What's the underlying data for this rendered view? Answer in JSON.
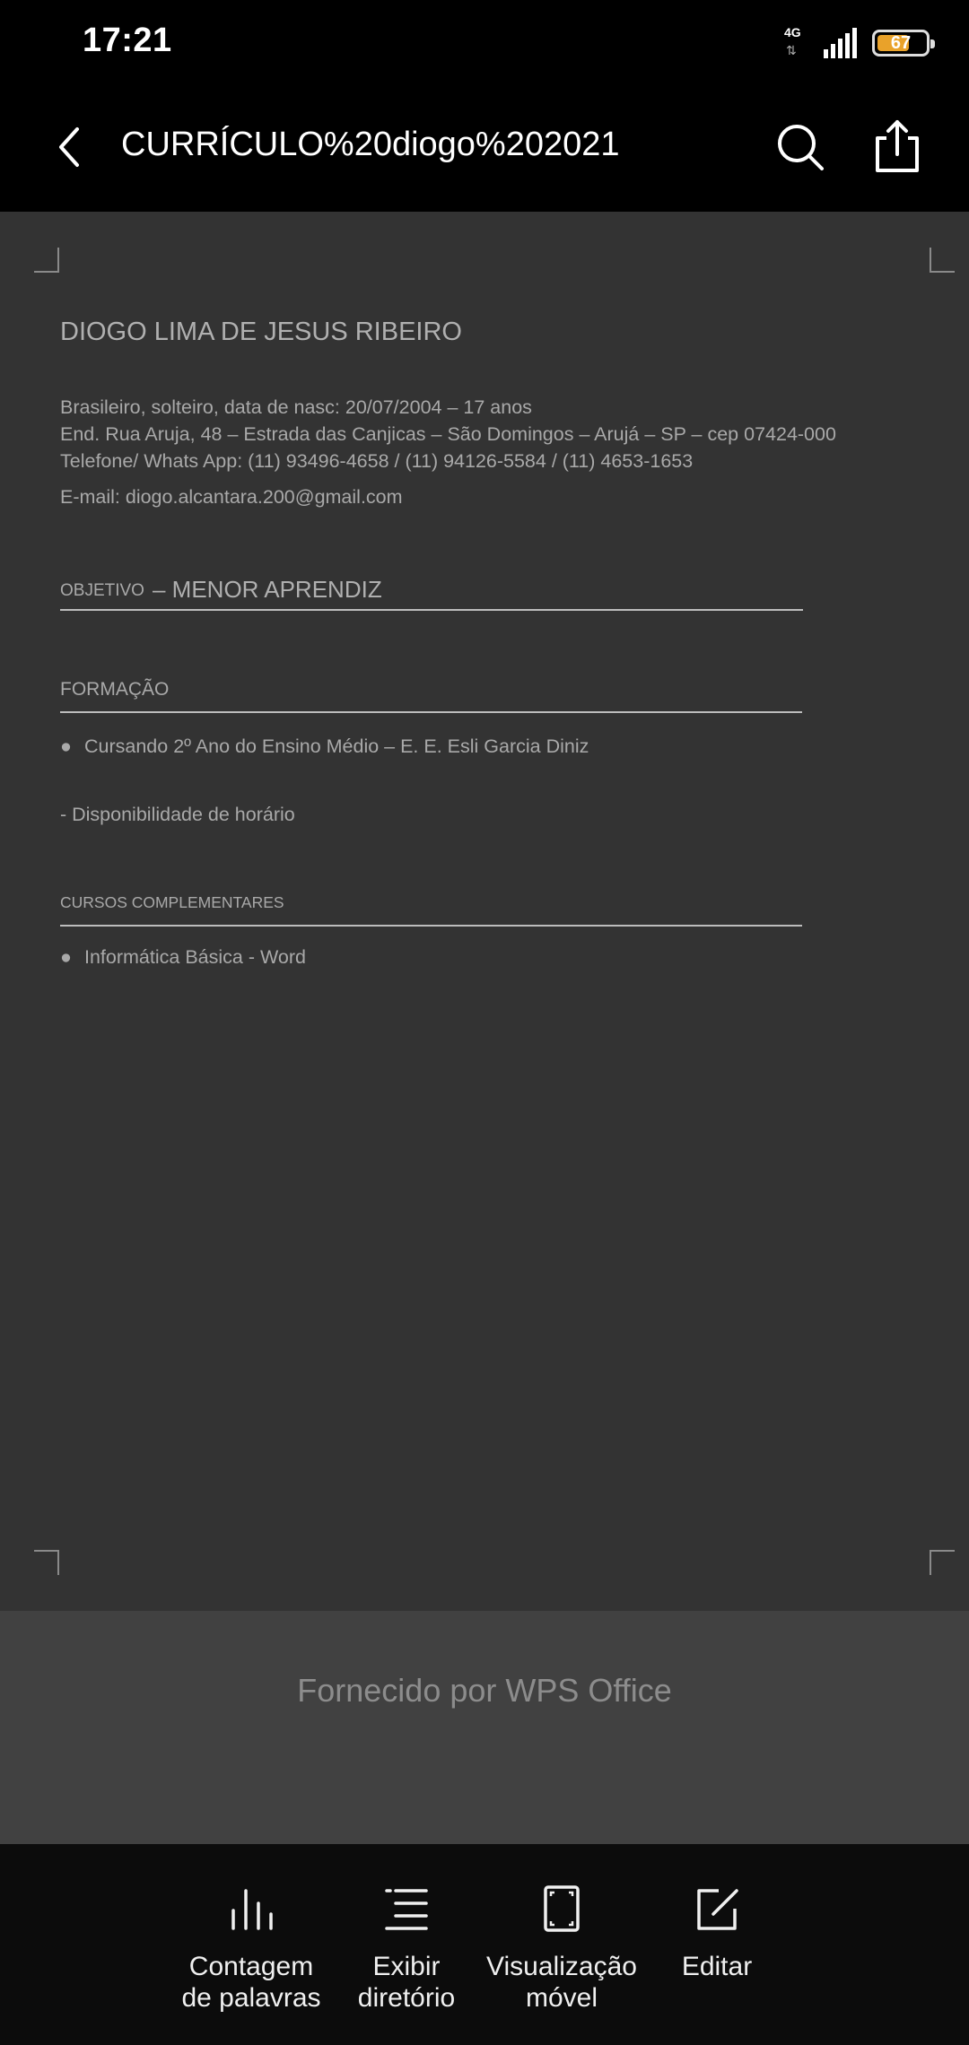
{
  "status_bar": {
    "time": "17:21",
    "network": "4G",
    "battery": "67",
    "battery_level": 0.67
  },
  "app_bar": {
    "title": "CURRÍCULO%20diogo%202021",
    "back_icon": "chevron-left-icon",
    "search_icon": "search-icon",
    "share_icon": "share-icon"
  },
  "document": {
    "name": "DIOGO LIMA DE JESUS RIBEIRO",
    "info_line1": "Brasileiro, solteiro, data de nasc: 20/07/2004 – 17 anos",
    "info_line2": "End. Rua Aruja, 48 – Estrada das Canjicas – São Domingos – Arujá – SP – cep 07424-000",
    "info_line3": "Telefone/ Whats App: (11) 93496-4658 / (11) 94126-5584 / (11) 4653-1653",
    "email": "E-mail: diogo.alcantara.200@gmail.com",
    "objetivo_label": "OBJETIVO",
    "objetivo_value": "– MENOR APRENDIZ",
    "formacao_title": "FORMAÇÃO",
    "formacao_item": "Cursando 2º Ano do Ensino Médio – E. E. Esli Garcia Diniz",
    "disponibilidade": "- Disponibilidade de horário",
    "cursos_title": "CURSOS COMPLEMENTARES",
    "cursos_item": "Informática Básica - Word",
    "bullet": "●"
  },
  "banner": {
    "text": "Fornecido por WPS Office"
  },
  "toolbar": {
    "items": [
      {
        "label_line1": "Contagem",
        "label_line2": "de palavras",
        "icon": "bar-chart-icon"
      },
      {
        "label_line1": "Exibir",
        "label_line2": "diretório",
        "icon": "list-icon"
      },
      {
        "label_line1": "Visualização",
        "label_line2": "móvel",
        "icon": "mobile-view-icon"
      },
      {
        "label_line1": "Editar",
        "label_line2": "",
        "icon": "edit-icon"
      }
    ]
  },
  "colors": {
    "document_background": "#333333",
    "banner_background": "#414141",
    "toolbar_background": "#0c0c0c",
    "battery_fill": "#e9a22a"
  }
}
